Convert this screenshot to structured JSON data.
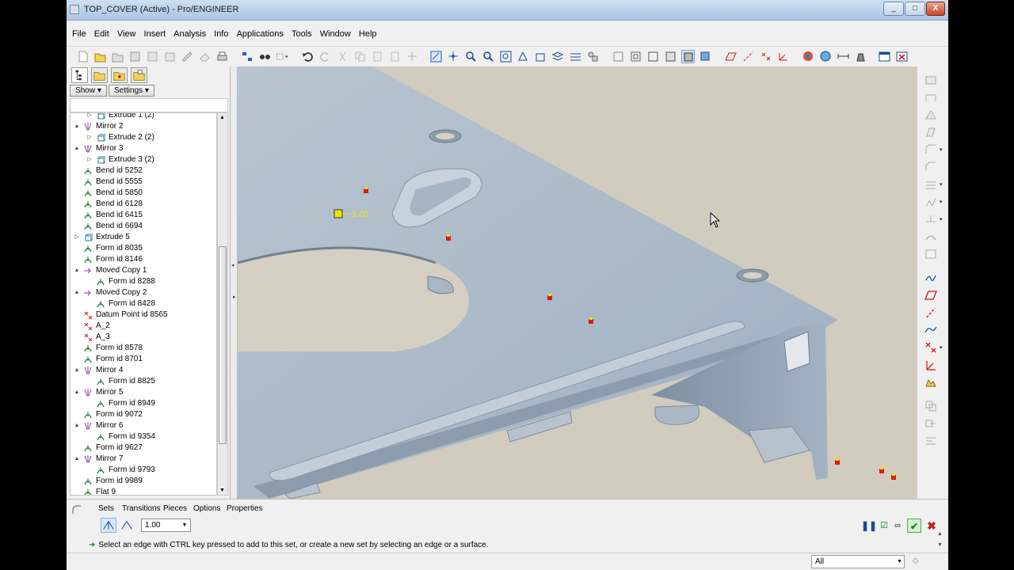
{
  "window": {
    "title": "TOP_COVER (Active) - Pro/ENGINEER",
    "buttons": {
      "minimize": "_",
      "maximize": "□",
      "close": "X"
    }
  },
  "menubar": {
    "items": [
      "File",
      "Edit",
      "View",
      "Insert",
      "Analysis",
      "Info",
      "Applications",
      "Tools",
      "Window",
      "Help"
    ]
  },
  "left_panel": {
    "show_label": "Show",
    "settings_label": "Settings",
    "tree": [
      {
        "label": "Extrude 1 (2)",
        "icon": "extrude-icon",
        "indent": 1,
        "arrow": "right"
      },
      {
        "label": "Mirror 2",
        "icon": "mirror-icon",
        "indent": 0,
        "arrow": "down"
      },
      {
        "label": "Extrude 2 (2)",
        "icon": "extrude-icon",
        "indent": 1,
        "arrow": "right"
      },
      {
        "label": "Mirror 3",
        "icon": "mirror-icon",
        "indent": 0,
        "arrow": "down"
      },
      {
        "label": "Extrude 3 (2)",
        "icon": "extrude-icon",
        "indent": 1,
        "arrow": "right"
      },
      {
        "label": "Bend id 5252",
        "icon": "bend-icon",
        "indent": 0,
        "arrow": ""
      },
      {
        "label": "Bend id 5555",
        "icon": "bend-icon",
        "indent": 0,
        "arrow": ""
      },
      {
        "label": "Bend id 5850",
        "icon": "bend-icon",
        "indent": 0,
        "arrow": ""
      },
      {
        "label": "Bend id 6128",
        "icon": "bend-icon",
        "indent": 0,
        "arrow": ""
      },
      {
        "label": "Bend id 6415",
        "icon": "bend-icon",
        "indent": 0,
        "arrow": ""
      },
      {
        "label": "Bend id 6694",
        "icon": "bend-icon",
        "indent": 0,
        "arrow": ""
      },
      {
        "label": "Extrude 5",
        "icon": "extrude-icon",
        "indent": 0,
        "arrow": "right"
      },
      {
        "label": "Form id 8035",
        "icon": "form-icon",
        "indent": 0,
        "arrow": ""
      },
      {
        "label": "Form id 8146",
        "icon": "form-icon",
        "indent": 0,
        "arrow": ""
      },
      {
        "label": "Moved Copy 1",
        "icon": "moved-copy-icon",
        "indent": 0,
        "arrow": "down"
      },
      {
        "label": "Form id 8288",
        "icon": "form-icon",
        "indent": 1,
        "arrow": ""
      },
      {
        "label": "Moved Copy 2",
        "icon": "moved-copy-icon",
        "indent": 0,
        "arrow": "down"
      },
      {
        "label": "Form id 8428",
        "icon": "form-icon",
        "indent": 1,
        "arrow": ""
      },
      {
        "label": "Datum Point id 8565",
        "icon": "datum-point-icon",
        "indent": 0,
        "arrow": ""
      },
      {
        "label": "A_2",
        "icon": "axis-icon",
        "indent": 0,
        "arrow": ""
      },
      {
        "label": "A_3",
        "icon": "axis-icon",
        "indent": 0,
        "arrow": ""
      },
      {
        "label": "Form id 8578",
        "icon": "form-icon",
        "indent": 0,
        "arrow": ""
      },
      {
        "label": "Form id 8701",
        "icon": "form-icon",
        "indent": 0,
        "arrow": ""
      },
      {
        "label": "Mirror 4",
        "icon": "mirror-icon",
        "indent": 0,
        "arrow": "down"
      },
      {
        "label": "Form id 8825",
        "icon": "form-icon",
        "indent": 1,
        "arrow": ""
      },
      {
        "label": "Mirror 5",
        "icon": "mirror-icon",
        "indent": 0,
        "arrow": "down"
      },
      {
        "label": "Form id 8949",
        "icon": "form-icon",
        "indent": 1,
        "arrow": ""
      },
      {
        "label": "Form id 9072",
        "icon": "form-icon",
        "indent": 0,
        "arrow": ""
      },
      {
        "label": "Mirror 6",
        "icon": "mirror-icon",
        "indent": 0,
        "arrow": "down"
      },
      {
        "label": "Form id 9354",
        "icon": "form-icon",
        "indent": 1,
        "arrow": ""
      },
      {
        "label": "Form id 9627",
        "icon": "form-icon",
        "indent": 0,
        "arrow": ""
      },
      {
        "label": "Mirror 7",
        "icon": "mirror-icon",
        "indent": 0,
        "arrow": "down"
      },
      {
        "label": "Form id 9793",
        "icon": "form-icon",
        "indent": 1,
        "arrow": ""
      },
      {
        "label": "Form id 9989",
        "icon": "form-icon",
        "indent": 0,
        "arrow": ""
      },
      {
        "label": "Flat 9",
        "icon": "flat-icon",
        "indent": 0,
        "arrow": ""
      }
    ]
  },
  "viewport": {
    "dimension_label": "1.00",
    "colors": {
      "background": "#d2ccbf",
      "sheet": "#a9b6c4",
      "sheet_light": "#b8c3cf",
      "marker": "#d21c1c",
      "marker_accent": "#f2e300"
    }
  },
  "dashboard": {
    "tabs": [
      "Sets",
      "Transitions",
      "Pieces",
      "Options",
      "Properties"
    ],
    "radius_value": "1.00",
    "status_message": "Select an edge with CTRL key pressed to add to this set, or create a new set by selecting an edge or a surface."
  },
  "bottombar": {
    "filter_value": "All"
  }
}
